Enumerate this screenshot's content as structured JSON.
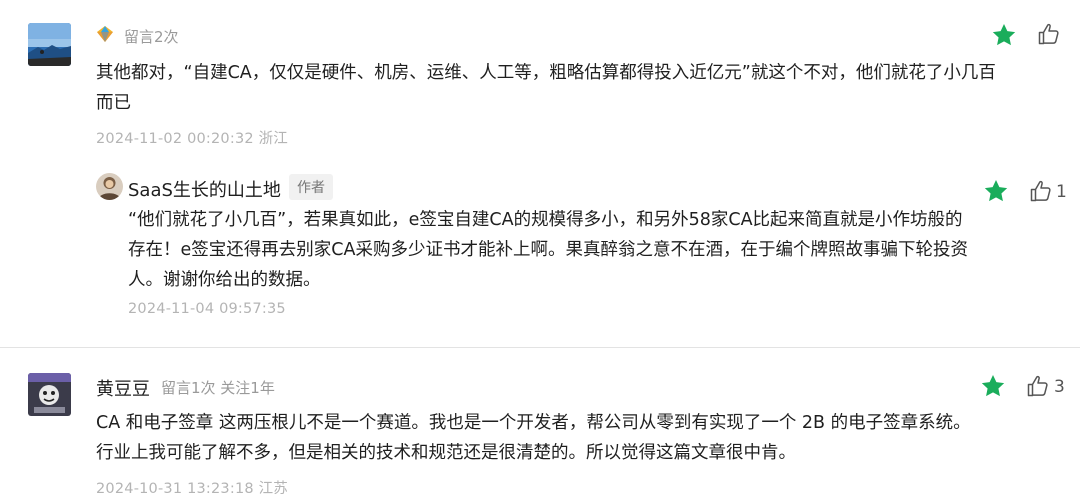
{
  "colors": {
    "star": "#1aad5b",
    "muted": "#9a9a9a",
    "timestamp": "#b4b4b4",
    "separator": "#e3e3e3"
  },
  "comments": [
    {
      "author_meta": "留言2次",
      "text": "其他都对，“自建CA，仅仅是硬件、机房、运维、人工等，粗略估算都得投入近亿元”就这个不对，他们就花了小几百而已",
      "timestamp": "2024-11-02 00:20:32 浙江",
      "like_count": "",
      "reply": {
        "author": "SaaS生长的山土地",
        "badge": "作者",
        "text": "“他们就花了小几百”，若果真如此，e签宝自建CA的规模得多小，和另外58家CA比起来简直就是小作坊般的存在！e签宝还得再去别家CA采购多少证书才能补上啊。果真醉翁之意不在酒，在于编个牌照故事骗下轮投资人。谢谢你给出的数据。",
        "timestamp": "2024-11-04 09:57:35",
        "like_count": "1"
      }
    },
    {
      "author": "黄豆豆",
      "author_meta": "留言1次 关注1年",
      "text": "CA 和电子签章 这两压根儿不是一个赛道。我也是一个开发者，帮公司从零到有实现了一个 2B 的电子签章系统。行业上我可能了解不多，但是相关的技术和规范还是很清楚的。所以觉得这篇文章很中肯。",
      "timestamp": "2024-10-31 13:23:18 江苏",
      "like_count": "3"
    }
  ]
}
